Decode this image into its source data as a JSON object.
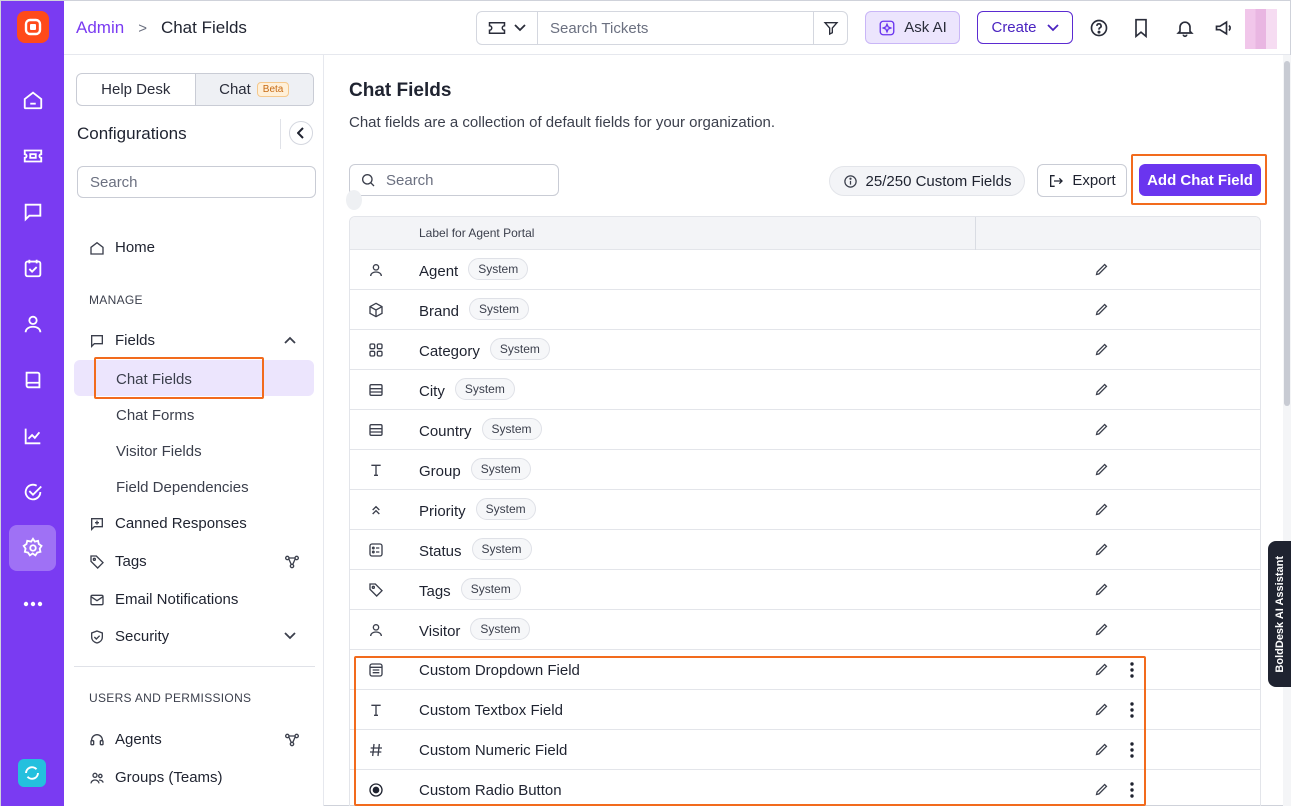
{
  "colors": {
    "rail": "#7a3bf2",
    "accent": "#6a35ef",
    "highlight": "#f26b1d",
    "logo": "#ff4a1a"
  },
  "rail": {
    "items": [
      "home-icon",
      "ticket-icon",
      "chat-icon",
      "task-icon",
      "contact-icon",
      "kb-icon",
      "reports-icon",
      "approval-icon",
      "settings-icon",
      "more-icon"
    ],
    "active": "settings-icon"
  },
  "header": {
    "breadcrumb_root": "Admin",
    "breadcrumb_sep": ">",
    "breadcrumb_current": "Chat Fields",
    "search_placeholder": "Search Tickets",
    "ask_ai": "Ask AI",
    "create": "Create"
  },
  "config": {
    "tabs": [
      {
        "label": "Help Desk"
      },
      {
        "label": "Chat",
        "badge": "Beta"
      }
    ],
    "title": "Configurations",
    "search_placeholder": "Search",
    "home": "Home",
    "manage_heading": "MANAGE",
    "fields": "Fields",
    "field_items": [
      "Chat Fields",
      "Chat Forms",
      "Visitor Fields",
      "Field Dependencies"
    ],
    "canned": "Canned Responses",
    "tags": "Tags",
    "email_notifications": "Email Notifications",
    "security": "Security",
    "users_heading": "USERS AND PERMISSIONS",
    "agents": "Agents",
    "groups": "Groups (Teams)"
  },
  "main": {
    "title": "Chat Fields",
    "description": "Chat fields are a collection of default fields for your organization.",
    "search_placeholder": "Search",
    "count": "25/250 Custom Fields",
    "export": "Export",
    "add": "Add Chat Field",
    "column_header": "Label for Agent Portal",
    "rows": [
      {
        "label": "Agent",
        "badge": "System",
        "icon": "user-icon"
      },
      {
        "label": "Brand",
        "badge": "System",
        "icon": "cube-icon"
      },
      {
        "label": "Category",
        "badge": "System",
        "icon": "grid-icon"
      },
      {
        "label": "City",
        "badge": "System",
        "icon": "list-box-icon"
      },
      {
        "label": "Country",
        "badge": "System",
        "icon": "list-box-icon"
      },
      {
        "label": "Group",
        "badge": "System",
        "icon": "text-icon"
      },
      {
        "label": "Priority",
        "badge": "System",
        "icon": "chevrons-up-icon"
      },
      {
        "label": "Status",
        "badge": "System",
        "icon": "status-icon"
      },
      {
        "label": "Tags",
        "badge": "System",
        "icon": "tag-icon"
      },
      {
        "label": "Visitor",
        "badge": "System",
        "icon": "user-icon"
      },
      {
        "label": "Custom Dropdown Field",
        "badge": "",
        "icon": "dropdown-list-icon"
      },
      {
        "label": "Custom Textbox Field",
        "badge": "",
        "icon": "text-icon"
      },
      {
        "label": "Custom Numeric Field",
        "badge": "",
        "icon": "hash-icon"
      },
      {
        "label": "Custom Radio Button",
        "badge": "",
        "icon": "radio-icon"
      }
    ]
  },
  "assistant": "BoldDesk AI Assistant"
}
